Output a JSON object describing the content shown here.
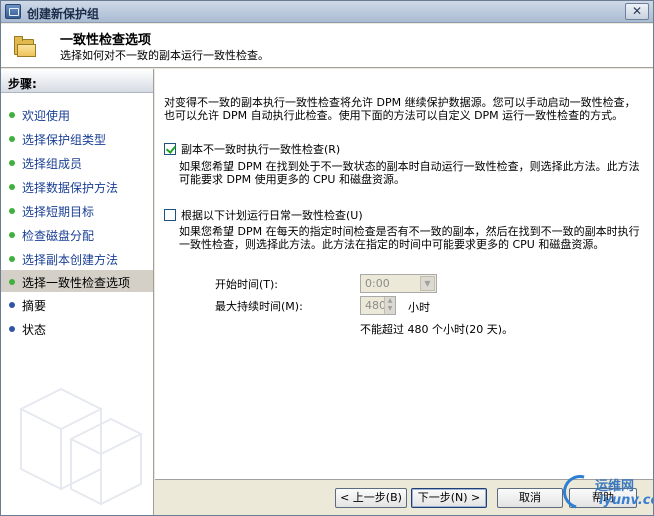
{
  "window": {
    "title": "创建新保护组",
    "close_glyph": "✕"
  },
  "header": {
    "title": "一致性检查选项",
    "subtitle": "选择如何对不一致的副本运行一致性检查。"
  },
  "sidebar": {
    "heading": "步骤:",
    "items": [
      {
        "label": "欢迎使用",
        "state": "done"
      },
      {
        "label": "选择保护组类型",
        "state": "done"
      },
      {
        "label": "选择组成员",
        "state": "done"
      },
      {
        "label": "选择数据保护方法",
        "state": "done"
      },
      {
        "label": "选择短期目标",
        "state": "done"
      },
      {
        "label": "检查磁盘分配",
        "state": "done"
      },
      {
        "label": "选择副本创建方法",
        "state": "done"
      },
      {
        "label": "选择一致性检查选项",
        "state": "current"
      },
      {
        "label": "摘要",
        "state": "todo"
      },
      {
        "label": "状态",
        "state": "todo"
      }
    ]
  },
  "main": {
    "intro_line1": "对变得不一致的副本执行一致性检查将允许 DPM 继续保护数据源。您可以手动启动一致性检查，",
    "intro_line2": "也可以允许 DPM 自动执行此检查。使用下面的方法可以自定义 DPM 运行一致性检查的方式。",
    "option1": {
      "label": "副本不一致时执行一致性检查(R)",
      "checked": true,
      "desc_line1": "如果您希望 DPM 在找到处于不一致状态的副本时自动运行一致性检查，则选择此方法。此方法",
      "desc_line2": "可能要求 DPM 使用更多的 CPU 和磁盘资源。"
    },
    "option2": {
      "label": "根据以下计划运行日常一致性检查(U)",
      "checked": false,
      "desc_line1": "如果您希望 DPM 在每天的指定时间检查是否有不一致的副本，然后在找到不一致的副本时执行",
      "desc_line2": "一致性检查，则选择此方法。此方法在指定的时间中可能要求更多的 CPU 和磁盘资源。"
    },
    "start_time": {
      "label": "开始时间(T):",
      "value": "0:00"
    },
    "max_duration": {
      "label": "最大持续时间(M):",
      "value": "480",
      "unit": "小时"
    },
    "limit_note": "不能超过 480 个小时(20 天)。"
  },
  "footer": {
    "back": "< 上一步(B)",
    "next": "下一步(N) >",
    "cancel": "取消",
    "help": "帮助"
  },
  "watermark_logo": {
    "line1": "运维网",
    "line2": "iyunv.com"
  },
  "colors": {
    "link": "#1a3f94",
    "done_dot": "#3fb13d",
    "todo_dot": "#2f55a5",
    "current_bg": "#d4d0c8"
  }
}
